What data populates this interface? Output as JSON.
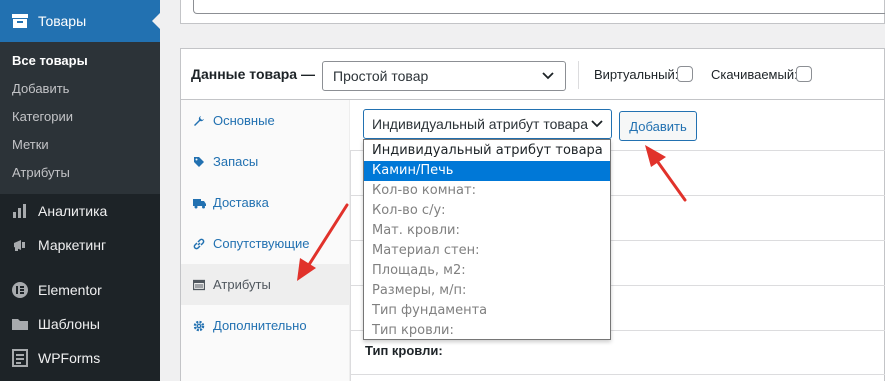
{
  "sidebar": {
    "active_menu": "Товары",
    "submenu": [
      "Все товары",
      "Добавить",
      "Категории",
      "Метки",
      "Атрибуты"
    ],
    "menu": [
      {
        "label": "Аналитика",
        "icon": "chart-bar-icon"
      },
      {
        "label": "Маркетинг",
        "icon": "megaphone-icon"
      },
      {
        "label": "Elementor",
        "icon": "elementor-icon"
      },
      {
        "label": "Шаблоны",
        "icon": "folder-icon"
      },
      {
        "label": "WPForms",
        "icon": "forms-icon"
      }
    ]
  },
  "product_data": {
    "title": "Данные товара —",
    "type_value": "Простой товар",
    "virtual_label": "Виртуальный:",
    "downloadable_label": "Скачиваемый:"
  },
  "tabs": [
    {
      "label": "Основные",
      "icon": "wrench-icon"
    },
    {
      "label": "Запасы",
      "icon": "tag-icon"
    },
    {
      "label": "Доставка",
      "icon": "truck-icon"
    },
    {
      "label": "Сопутствующие",
      "icon": "link-icon"
    },
    {
      "label": "Атрибуты",
      "icon": "table-icon"
    },
    {
      "label": "Дополнительно",
      "icon": "gear-icon"
    }
  ],
  "attributes": {
    "select_value": "Индивидуальный атрибут товара",
    "add_button": "Добавить",
    "options": [
      "Индивидуальный атрибут товара",
      "Камин/Печь",
      "Кол-во комнат:",
      "Кол-во с/у:",
      "Мат. кровли:",
      "Материал стен:",
      "Площадь, м2:",
      "Размеры, м/п:",
      "Тип фундамента",
      "Тип кровли:"
    ],
    "visible_attr_name": "Тип кровли:"
  },
  "colors": {
    "accent": "#2271b1",
    "sidebar": "#1d2327",
    "annotation_arrow": "#e1322b",
    "selected_option": "#0078d7"
  }
}
